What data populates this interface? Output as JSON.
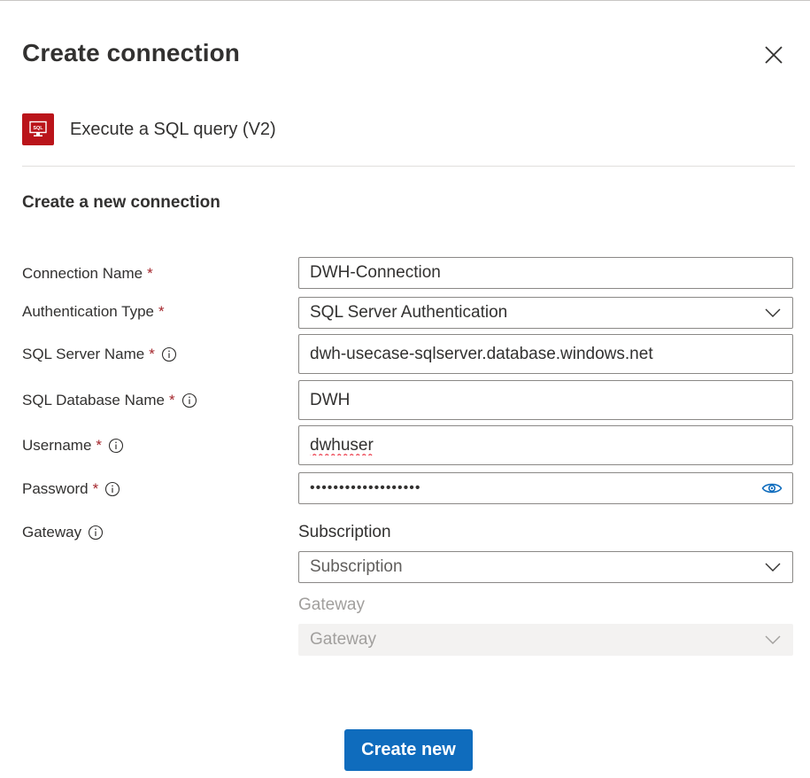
{
  "panel": {
    "title": "Create connection",
    "action_name": "Execute a SQL query (V2)",
    "action_icon": "sql-server-icon",
    "action_icon_text": "SQL",
    "section_title": "Create a new connection"
  },
  "fields": {
    "connection_name": {
      "label": "Connection Name",
      "required": "*",
      "value": "DWH-Connection"
    },
    "auth_type": {
      "label": "Authentication Type",
      "required": "*",
      "value": "SQL Server Authentication"
    },
    "server_name": {
      "label": "SQL Server Name",
      "required": "*",
      "value": "dwh-usecase-sqlserver.database.windows.net"
    },
    "database_name": {
      "label": "SQL Database Name",
      "required": "*",
      "value": "DWH"
    },
    "username": {
      "label": "Username",
      "required": "*",
      "value": "dwhuser"
    },
    "password": {
      "label": "Password",
      "required": "*",
      "value": "•••••••••••••••••••"
    },
    "gateway": {
      "label": "Gateway"
    }
  },
  "gateway_section": {
    "subscription_label": "Subscription",
    "subscription_value": "Subscription",
    "gateway_label": "Gateway",
    "gateway_value": "Gateway"
  },
  "buttons": {
    "create_new": "Create new"
  },
  "colors": {
    "primary": "#0f6cbd",
    "required": "#a4262c",
    "icon_bg": "#ba141a",
    "eye_icon": "#0f6cbd"
  }
}
